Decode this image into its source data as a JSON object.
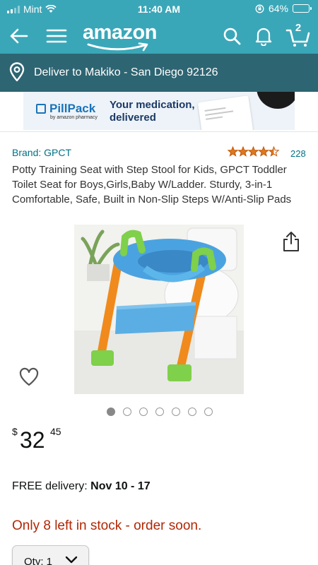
{
  "status_bar": {
    "carrier": "Mint",
    "time": "11:40 AM",
    "battery": "64%",
    "battery_level": 0.64
  },
  "header": {
    "logo": "amazon",
    "cart_count": "2",
    "icons": [
      "back-arrow-icon",
      "menu-icon",
      "search-icon",
      "bell-icon",
      "cart-icon"
    ]
  },
  "deliver": {
    "text": "Deliver to Makiko - San Diego 92126",
    "icon": "location-pin-icon"
  },
  "ad": {
    "brand": "PillPack",
    "brand_sub": "by amazon pharmacy",
    "headline_line1": "Your medication,",
    "headline_line2": "delivered"
  },
  "product": {
    "brand_label": "Brand: GPCT",
    "rating_stars": 4.5,
    "rating_count": "228",
    "title": "Potty Training Seat with Step Stool for Kids, GPCT Toddler Toilet Seat for Boys,Girls,Baby W/Ladder. Sturdy, 3-in-1 Comfortable, Safe, Built in Non-Slip Steps W/Anti-Slip Pads",
    "image_count": 7,
    "active_image": 0
  },
  "price": {
    "symbol": "$",
    "whole": "32",
    "fraction": "45"
  },
  "delivery": {
    "prefix": "FREE delivery: ",
    "dates": "Nov 10 - 17"
  },
  "stock": {
    "text": "Only 8 left in stock - order soon."
  },
  "quantity": {
    "label": "Qty: 1"
  },
  "colors": {
    "header": "#3aa7b8",
    "deliver_bar": "#2e6572",
    "link": "#007185",
    "stars": "#de7921",
    "stock": "#b12704"
  }
}
